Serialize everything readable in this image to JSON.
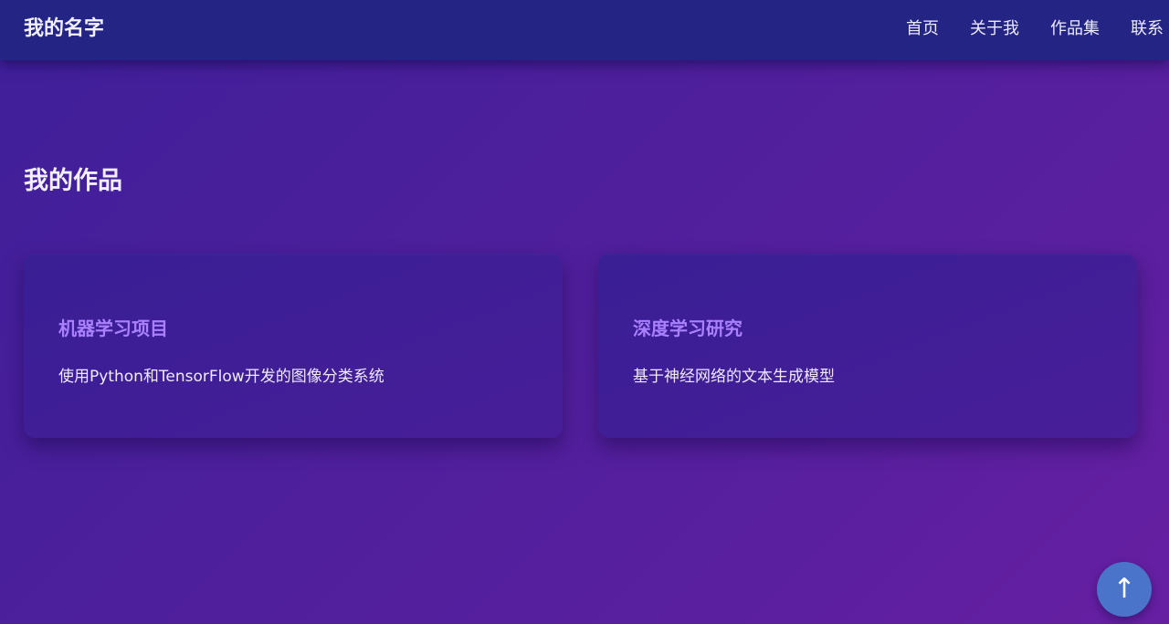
{
  "navbar": {
    "brand": "我的名字",
    "links": [
      {
        "label": "首页"
      },
      {
        "label": "关于我"
      },
      {
        "label": "作品集"
      },
      {
        "label": "联系"
      }
    ]
  },
  "portfolio": {
    "title": "我的作品",
    "projects": [
      {
        "title": "机器学习项目",
        "description": "使用Python和TensorFlow开发的图像分类系统"
      },
      {
        "title": "深度学习研究",
        "description": "基于神经网络的文本生成模型"
      }
    ]
  },
  "back_to_top": {
    "icon": "arrow-up-icon",
    "glyph": "↑"
  },
  "colors": {
    "navbar": "#232483",
    "accent_title": "#a980ff",
    "button": "#4a74c9"
  }
}
